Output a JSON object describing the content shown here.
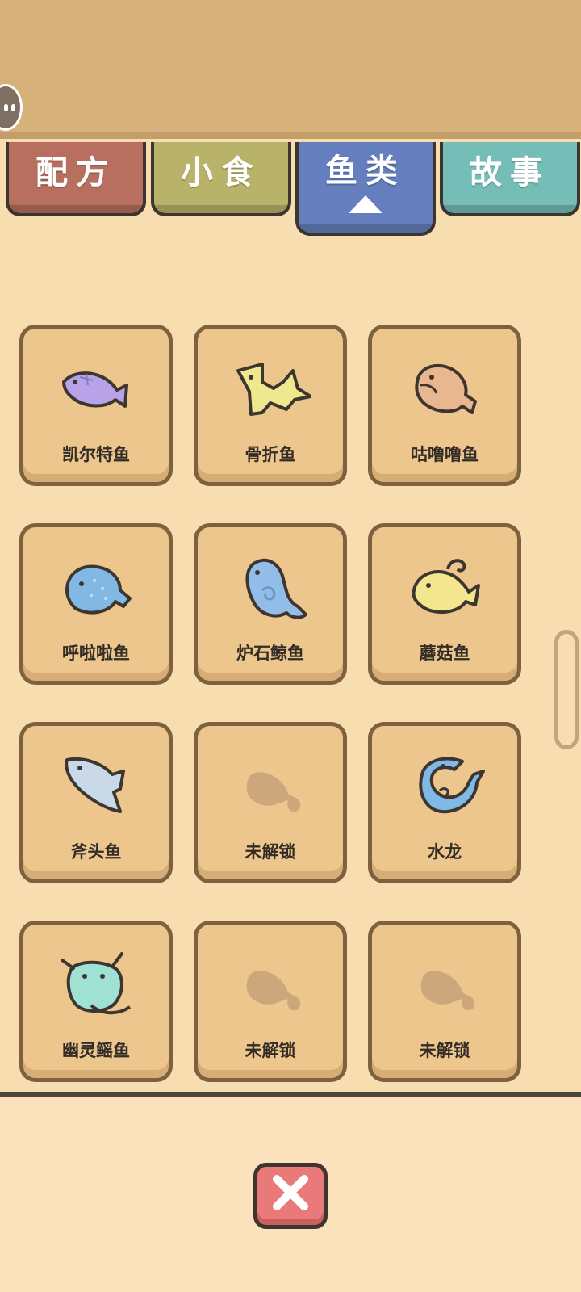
{
  "tabs": [
    {
      "label": "配方",
      "color": "#b96f60",
      "active": false
    },
    {
      "label": "小食",
      "color": "#b9b369",
      "active": false
    },
    {
      "label": "鱼类",
      "color": "#657fbe",
      "active": true
    },
    {
      "label": "故事",
      "color": "#75bdb7",
      "active": false
    }
  ],
  "fish": [
    {
      "name": "凯尔特鱼",
      "icon": "celtic-fish-icon",
      "color": "#b9a3e8",
      "unlocked": true
    },
    {
      "name": "骨折鱼",
      "icon": "broken-bone-fish-icon",
      "color": "#efe88f",
      "unlocked": true
    },
    {
      "name": "咕噜噜鱼",
      "icon": "gululu-fish-icon",
      "color": "#e9b78f",
      "unlocked": true
    },
    {
      "name": "呼啦啦鱼",
      "icon": "hulala-fish-icon",
      "color": "#82b9e4",
      "unlocked": true
    },
    {
      "name": "炉石鲸鱼",
      "icon": "hearthstone-whale-icon",
      "color": "#93bde9",
      "unlocked": true
    },
    {
      "name": "蘑菇鱼",
      "icon": "mushroom-fish-icon",
      "color": "#f4e58f",
      "unlocked": true
    },
    {
      "name": "斧头鱼",
      "icon": "axe-fish-icon",
      "color": "#cad9e7",
      "unlocked": true
    },
    {
      "name": "未解锁",
      "icon": "locked-fish-silhouette-icon",
      "color": "#c9a37a",
      "unlocked": false
    },
    {
      "name": "水龙",
      "icon": "water-dragon-icon",
      "color": "#7fb9e5",
      "unlocked": true
    },
    {
      "name": "幽灵鳐鱼",
      "icon": "ghost-ray-icon",
      "color": "#9fe1d2",
      "unlocked": true
    },
    {
      "name": "未解锁",
      "icon": "locked-fish-silhouette-icon",
      "color": "#c9a37a",
      "unlocked": false
    },
    {
      "name": "未解锁",
      "icon": "locked-fish-silhouette-icon",
      "color": "#c9a37a",
      "unlocked": false
    }
  ],
  "close_button": {
    "icon": "close-icon"
  }
}
